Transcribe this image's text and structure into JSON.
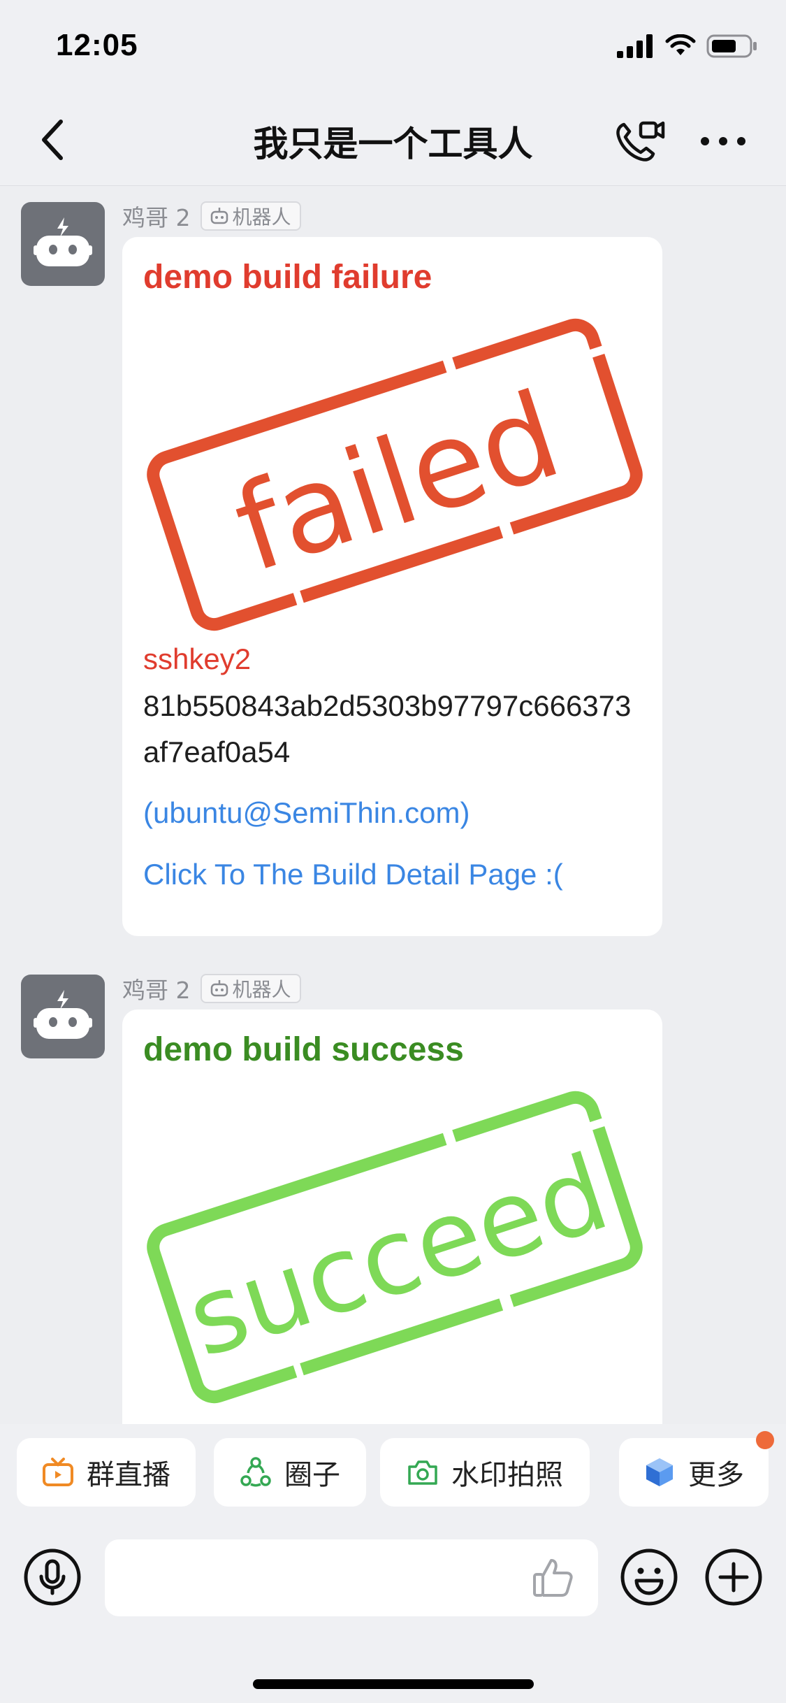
{
  "status_bar": {
    "time": "12:05"
  },
  "nav": {
    "title": "我只是一个工具人"
  },
  "messages": [
    {
      "sender": "鸡哥 2",
      "badge": "机器人",
      "title": "demo build failure",
      "status": "failure",
      "stamp_text": "failed",
      "stamp_color": "#E2502F",
      "lines": {
        "key_name": "sshkey2",
        "commit_hash": "81b550843ab2d5303b97797c666373af7eaf0a54",
        "author": "(ubuntu@SemiThin.com)",
        "link": "Click To The Build Detail Page :("
      }
    },
    {
      "sender": "鸡哥 2",
      "badge": "机器人",
      "title": "demo build success",
      "status": "success",
      "stamp_text": "succeed",
      "stamp_color": "#7ED957"
    }
  ],
  "quick_actions": [
    {
      "label": "群直播",
      "icon": "tv-icon",
      "color": "#F08A24"
    },
    {
      "label": "圈子",
      "icon": "circle-group-icon",
      "color": "#34A853"
    },
    {
      "label": "水印拍照",
      "icon": "camera-icon",
      "color": "#34A853"
    },
    {
      "label": "更多",
      "icon": "cube-icon",
      "color": "#3B7DE9",
      "has_badge": true
    }
  ],
  "input": {
    "value": "",
    "placeholder": ""
  },
  "colors": {
    "failure": "#E03C2E",
    "success": "#3A8C22",
    "link": "#3A86E3",
    "badge": "#EE6A3A"
  }
}
